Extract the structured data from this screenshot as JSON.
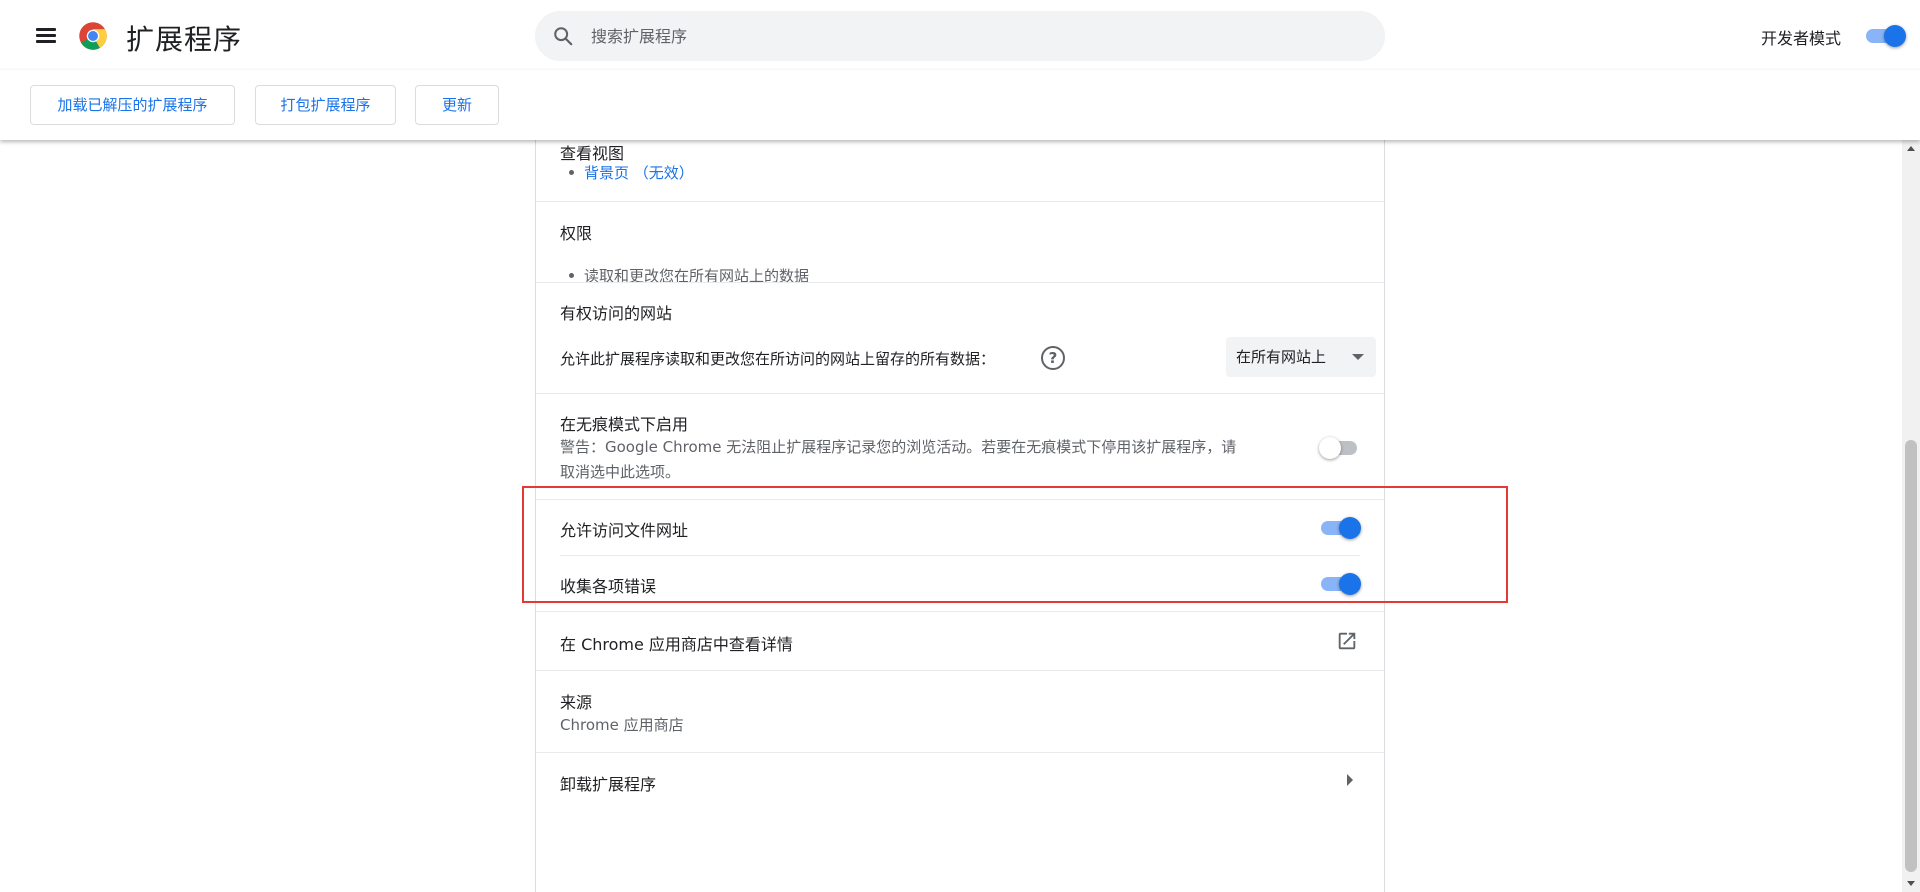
{
  "header": {
    "app_title": "扩展程序",
    "search_placeholder": "搜索扩展程序",
    "dev_mode_label": "开发者模式",
    "dev_mode_on": true
  },
  "toolbar": {
    "load_unpacked": "加载已解压的扩展程序",
    "pack": "打包扩展程序",
    "update": "更新"
  },
  "details": {
    "views": {
      "title": "查看视图",
      "items": [
        "背景页 （无效）"
      ]
    },
    "permissions": {
      "title": "权限",
      "items": [
        "读取和更改您在所有网站上的数据"
      ]
    },
    "site_access": {
      "title": "有权访问的网站",
      "description": "允许此扩展程序读取和更改您在所访问的网站上留存的所有数据：",
      "selected": "在所有网站上"
    },
    "incognito": {
      "title": "在无痕模式下启用",
      "warning_line1": "警告：Google Chrome 无法阻止扩展程序记录您的浏览活动。若要在无痕模式下停用该扩展程序，请",
      "warning_line2": "取消选中此选项。",
      "enabled": false
    },
    "file_urls": {
      "title": "允许访问文件网址",
      "enabled": true
    },
    "collect_errors": {
      "title": "收集各项错误",
      "enabled": true
    },
    "webstore": {
      "title": "在 Chrome 应用商店中查看详情"
    },
    "source": {
      "title": "来源",
      "value": "Chrome 应用商店"
    },
    "remove": {
      "title": "卸载扩展程序"
    }
  },
  "colors": {
    "accent": "#1a73e8",
    "toggle_track_on": "#8ab4f8",
    "highlight": "#e53935"
  }
}
